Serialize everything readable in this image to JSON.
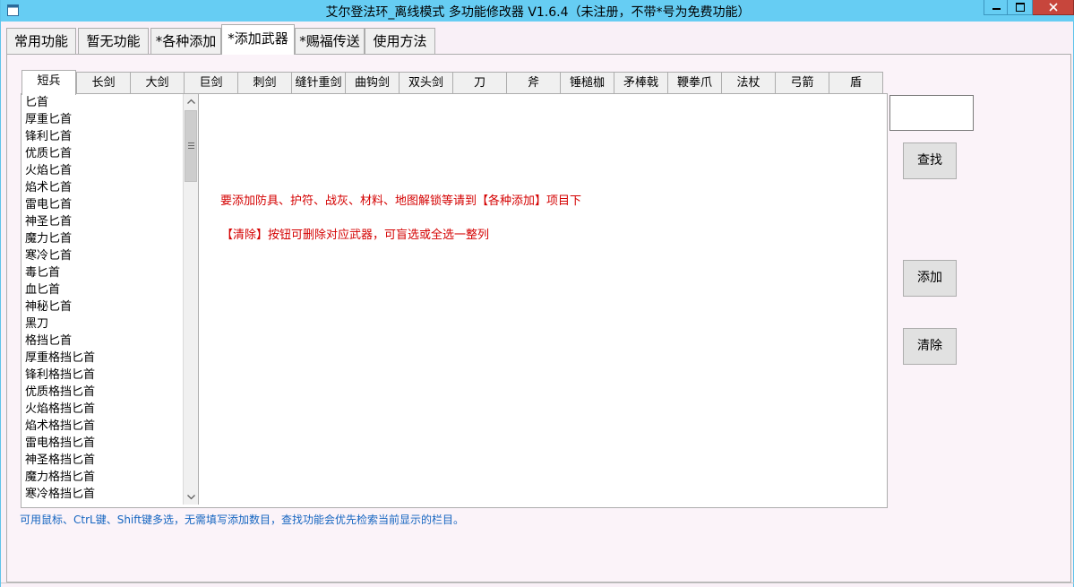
{
  "window": {
    "title": "艾尔登法环_离线模式 多功能修改器  V1.6.4（未注册，不带*号为免费功能）",
    "accent_color": "#66cdf3",
    "close_color": "#c7463c"
  },
  "main_tabs": [
    {
      "label": "常用功能"
    },
    {
      "label": "暂无功能"
    },
    {
      "label": "*各种添加"
    },
    {
      "label": "*添加武器"
    },
    {
      "label": "*赐福传送"
    },
    {
      "label": "使用方法"
    }
  ],
  "weapon_tabs": [
    {
      "label": "短兵"
    },
    {
      "label": "长剑"
    },
    {
      "label": "大剑"
    },
    {
      "label": "巨剑"
    },
    {
      "label": "刺剑"
    },
    {
      "label": "缝针重剑"
    },
    {
      "label": "曲钩剑"
    },
    {
      "label": "双头剑"
    },
    {
      "label": "刀"
    },
    {
      "label": "斧"
    },
    {
      "label": "锤槌枷"
    },
    {
      "label": "矛棒戟"
    },
    {
      "label": "鞭拳爪"
    },
    {
      "label": "法杖"
    },
    {
      "label": "弓箭"
    },
    {
      "label": "盾"
    }
  ],
  "weapon_list": [
    "匕首",
    "厚重匕首",
    "锋利匕首",
    "优质匕首",
    "火焰匕首",
    "焰术匕首",
    "雷电匕首",
    "神圣匕首",
    "魔力匕首",
    "寒冷匕首",
    "毒匕首",
    "血匕首",
    "神秘匕首",
    "黑刀",
    "格挡匕首",
    "厚重格挡匕首",
    "锋利格挡匕首",
    "优质格挡匕首",
    "火焰格挡匕首",
    "焰术格挡匕首",
    "雷电格挡匕首",
    "神圣格挡匕首",
    "魔力格挡匕首",
    "寒冷格挡匕首"
  ],
  "info_lines": {
    "line1": "要添加防具、护符、战灰、材料、地图解锁等请到【各种添加】项目下",
    "line2": "【清除】按钮可删除对应武器，可盲选或全选一整列"
  },
  "hint": "可用鼠标、CtrL键、Shift键多选，无需填写添加数目，查找功能会优先检索当前显示的栏目。",
  "search": {
    "value": ""
  },
  "buttons": {
    "find": "查找",
    "add": "添加",
    "clear": "清除"
  }
}
